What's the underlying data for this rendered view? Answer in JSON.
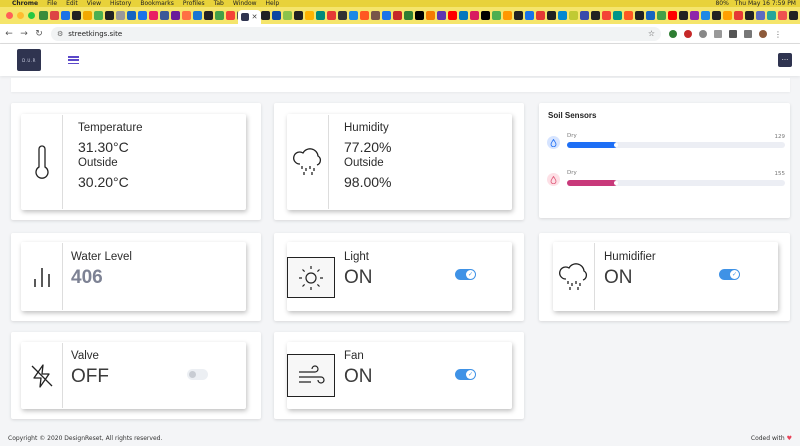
{
  "os_menu": {
    "app": "Chrome",
    "items": [
      "File",
      "Edit",
      "View",
      "History",
      "Bookmarks",
      "Profiles",
      "Tab",
      "Window",
      "Help"
    ],
    "battery": "80%",
    "clock": "Thu May 16  7:59 PM"
  },
  "browser": {
    "url": "streetkings.site",
    "favicon_colors": [
      "#3b8b3b",
      "#d44",
      "#1a73e8",
      "#222",
      "#f2a900",
      "#4caf50",
      "#222",
      "#999",
      "#1565c0",
      "#1a73e8",
      "#e91e63",
      "#3b5998",
      "#6a1b9a",
      "#ff7043",
      "#1976d2",
      "#222",
      "#43a047",
      "#f44336",
      "#555",
      "#e53935",
      "#222",
      "#0d47a1",
      "#8bc34a",
      "#222",
      "#ffb300",
      "#00897b",
      "#e53935",
      "#333",
      "#1e88e5",
      "#ff5722",
      "#795548",
      "#1a73e8",
      "#c62828",
      "#2e7d32",
      "#000",
      "#f57c00",
      "#5e35b1",
      "#ff0000",
      "#0277bd",
      "#d81b60",
      "#000",
      "#4caf50",
      "#ff9800",
      "#222",
      "#1a73e8",
      "#e53935",
      "#222",
      "#0288d1",
      "#c0ca33",
      "#3949ab",
      "#222",
      "#f44336",
      "#009688",
      "#ff5722",
      "#222",
      "#1565c0",
      "#43a047",
      "#ff0000",
      "#222",
      "#8e24aa",
      "#1e88e5",
      "#222",
      "#ffa000",
      "#e53935",
      "#222",
      "#5c6bc0",
      "#26a69a",
      "#ef5350",
      "#222",
      "#7e57c2",
      "#ff7043",
      "#222",
      "#29b6f6",
      "#66bb6a"
    ]
  },
  "header": {
    "logo_text": "D.U.R",
    "more_icon": "ellipsis-icon"
  },
  "cards": {
    "temperature": {
      "label": "Temperature",
      "value": "31.30°C",
      "outside_label": "Outside",
      "outside_value": "30.20°C",
      "icon": "thermometer-icon"
    },
    "humidity": {
      "label": "Humidity",
      "value": "77.20%",
      "outside_label": "Outside",
      "outside_value": "98.00%",
      "icon": "cloud-rain-icon"
    },
    "water_level": {
      "label": "Water Level",
      "value": "406",
      "icon": "bar-chart-icon"
    },
    "light": {
      "label": "Light",
      "state": "ON",
      "on": true,
      "icon": "sun-icon"
    },
    "humidifier": {
      "label": "Humidifier",
      "state": "ON",
      "on": true,
      "icon": "cloud-drizzle-icon"
    },
    "valve": {
      "label": "Valve",
      "state": "OFF",
      "on": false,
      "icon": "zap-off-icon"
    },
    "fan": {
      "label": "Fan",
      "state": "ON",
      "on": true,
      "icon": "wind-icon"
    }
  },
  "soil": {
    "title": "Soil Sensors",
    "sensors": [
      {
        "label": "Dry",
        "value": "129",
        "level": 0.23,
        "color": "#1e6ff5",
        "icon_bg": "#d6e4ff",
        "icon_color": "#1e6ff5"
      },
      {
        "label": "Dry",
        "value": "155",
        "level": 0.23,
        "color": "#c8397a",
        "icon_bg": "#fde0e6",
        "icon_color": "#e05a7a"
      }
    ]
  },
  "footer": {
    "copyright": "Copyright © 2020 DesignReset, All rights reserved.",
    "coded": "Coded with",
    "heart": "♥"
  }
}
